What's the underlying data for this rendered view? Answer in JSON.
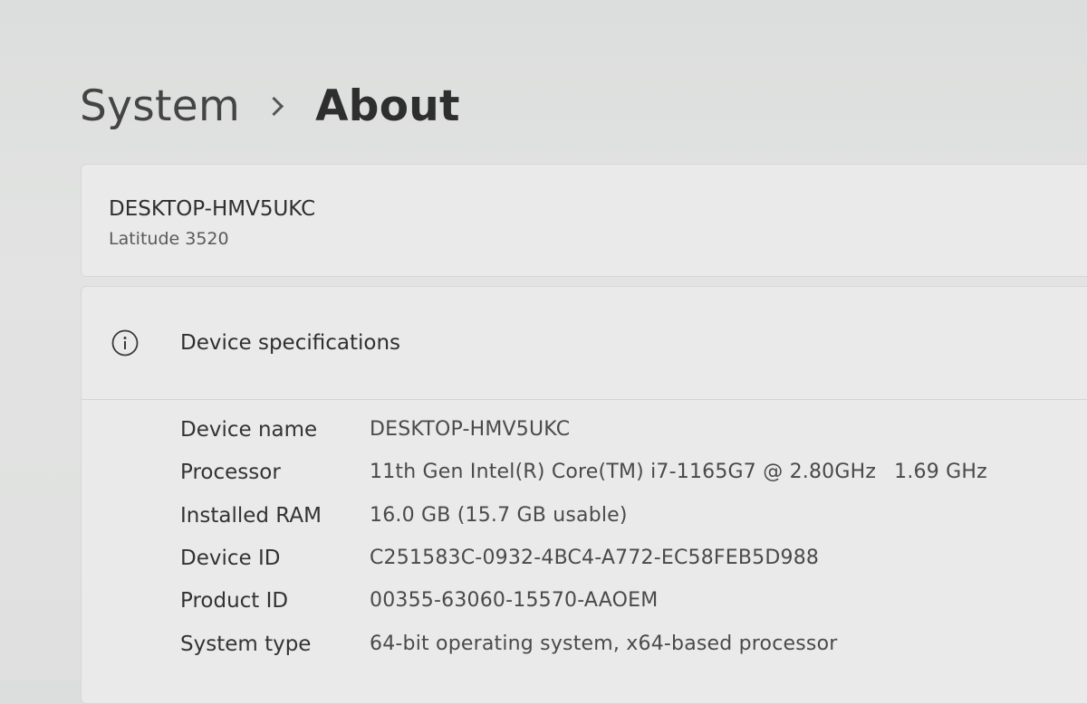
{
  "breadcrumb": {
    "parent": "System",
    "current": "About"
  },
  "device": {
    "name": "DESKTOP-HMV5UKC",
    "model": "Latitude 3520"
  },
  "specs": {
    "title": "Device specifications",
    "icon": "info-icon",
    "rows": [
      {
        "label": "Device name",
        "value": "DESKTOP-HMV5UKC"
      },
      {
        "label": "Processor",
        "value": "11th Gen Intel(R) Core(TM) i7-1165G7 @ 2.80GHz",
        "value2": "1.69 GHz"
      },
      {
        "label": "Installed RAM",
        "value": "16.0 GB (15.7 GB usable)"
      },
      {
        "label": "Device ID",
        "value": "C251583C-0932-4BC4-A772-EC58FEB5D988"
      },
      {
        "label": "Product ID",
        "value": "00355-63060-15570-AAOEM"
      },
      {
        "label": "System type",
        "value": "64-bit operating system, x64-based processor"
      }
    ]
  }
}
